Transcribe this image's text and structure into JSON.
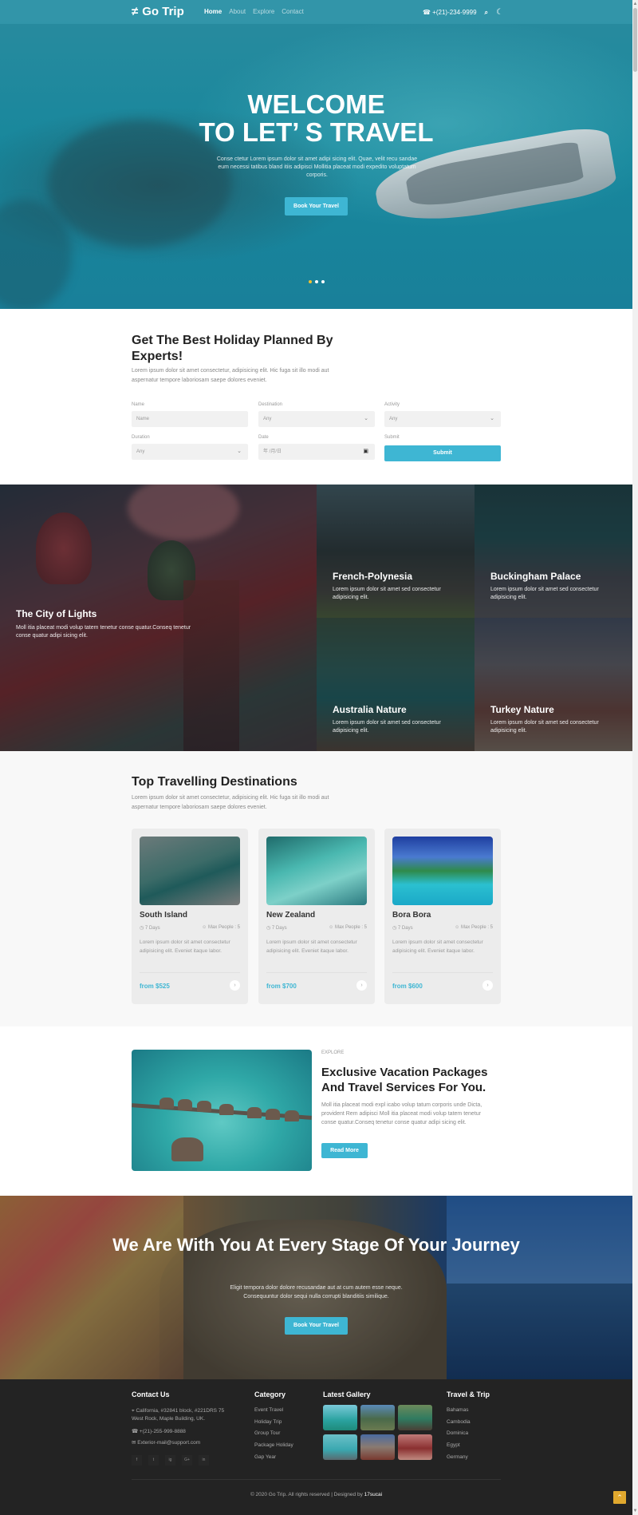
{
  "header": {
    "logo": "Go Trip",
    "logo_icon": "signpost-icon",
    "nav": [
      {
        "label": "Home",
        "active": true
      },
      {
        "label": "About",
        "active": false
      },
      {
        "label": "Explore",
        "active": false
      },
      {
        "label": "Contact",
        "active": false
      }
    ],
    "phone": "+(21)-234-9999",
    "phone_icon": "☎",
    "search_icon": "⌕",
    "theme_icon": "☾"
  },
  "hero": {
    "title_line1": "WELCOME",
    "title_line2": "TO LET’ S TRAVEL",
    "text": "Conse ctetur Lorem ipsum dolor sit amet adipi sicing elit. Quae, velit recu sandae eum necessi tatibus bland itiis adipisci Mollitia placeat modi expedito voluptatum corporis.",
    "button": "Book Your Travel",
    "slides": 3,
    "active_slide": 1
  },
  "planner": {
    "title": "Get The Best Holiday Planned By Experts!",
    "subtitle": "Lorem ipsum dolor sit amet consectetur, adipisicing elit. Hic fuga sit illo modi aut aspernatur tempore laboriosam saepe dolores eveniet.",
    "fields": {
      "name": {
        "label": "Name",
        "placeholder": "Name"
      },
      "destination": {
        "label": "Destination",
        "value": "Any"
      },
      "activity": {
        "label": "Activity",
        "value": "Any"
      },
      "duration": {
        "label": "Duration",
        "value": "Any"
      },
      "date": {
        "label": "Date",
        "placeholder": "年 /月/日"
      },
      "submit": {
        "label": "Submit",
        "button": "Submit"
      }
    }
  },
  "grid": {
    "big": {
      "title": "The City of Lights",
      "text": "Moll itia placeat modi volup tatem tenetur conse quatur.Conseq tenetur conse quatur adipi sicing elit."
    },
    "tiles": [
      {
        "title": "French-Polynesia",
        "text": "Lorem ipsum dolor sit amet sed consectetur adipisicing elit."
      },
      {
        "title": "Buckingham Palace",
        "text": "Lorem ipsum dolor sit amet sed consectetur adipisicing elit."
      },
      {
        "title": "Australia Nature",
        "text": "Lorem ipsum dolor sit amet sed consectetur adipisicing elit."
      },
      {
        "title": "Turkey Nature",
        "text": "Lorem ipsum dolor sit amet sed consectetur adipisicing elit."
      }
    ]
  },
  "destinations": {
    "title": "Top Travelling Destinations",
    "subtitle": "Lorem ipsum dolor sit amet consectetur, adipisicing elit. Hic fuga sit illo modi aut aspernatur tempore laboriosam saepe dolores eveniet.",
    "cards": [
      {
        "name": "South Island",
        "days": "7 Days",
        "people": "Max People : 5",
        "desc": "Lorem ipsum dolor sit amet consectetur adipisicing elit. Eveniet itaque labor.",
        "price": "from $525"
      },
      {
        "name": "New Zealand",
        "days": "7 Days",
        "people": "Max People : 5",
        "desc": "Lorem ipsum dolor sit amet consectetur adipisicing elit. Eveniet itaque labor.",
        "price": "from $700"
      },
      {
        "name": "Bora Bora",
        "days": "7 Days",
        "people": "Max People : 5",
        "desc": "Lorem ipsum dolor sit amet consectetur adipisicing elit. Eveniet itaque labor.",
        "price": "from $600"
      }
    ]
  },
  "explore": {
    "kicker": "EXPLORE",
    "title": "Exclusive Vacation Packages And Travel Services For You.",
    "text": "Moll itia placeat modi expl icabo volup tatum corporis unde Dicta, provident Rem adipisci Moll itia placeat modi volup tatem tenetur conse quatur.Conseq tenetur conse quatur adipi sicing elit.",
    "button": "Read More"
  },
  "cta": {
    "title": "We Are With You At Every Stage Of Your Journey",
    "text": "Eligit tempora dolor dolore recusandae aut at cum autem esse neque. Consequuntur dolor sequi nulla corrupti blanditiis similique.",
    "button": "Book Your Travel"
  },
  "footer": {
    "contact": {
      "title": "Contact Us",
      "address": "California, #32841 block, #221DRS 75 West Rock, Maple Building, UK.",
      "phone": "+(21)-255-999-8888",
      "email": "Exterior-mail@support.com",
      "socials": [
        "f",
        "t",
        "ig",
        "G+",
        "in"
      ]
    },
    "category": {
      "title": "Category",
      "items": [
        "Event Travel",
        "Holiday Trip",
        "Group Tour",
        "Package Holiday",
        "Gap Year"
      ]
    },
    "gallery": {
      "title": "Latest Gallery",
      "count": 6
    },
    "travel": {
      "title": "Travel & Trip",
      "items": [
        "Bahamas",
        "Cambodia",
        "Dominica",
        "Egypt",
        "Germany"
      ]
    },
    "copyright": "© 2020 Go Trip. All rights reserved | Designed by",
    "designer": "17sucai",
    "to_top_icon": "⌃"
  },
  "colors": {
    "accent": "#3eb6d3",
    "header_bg": "#3496aa",
    "footer_bg": "#232323",
    "to_top": "#e0a82e",
    "active_dot": "#f0c030"
  }
}
